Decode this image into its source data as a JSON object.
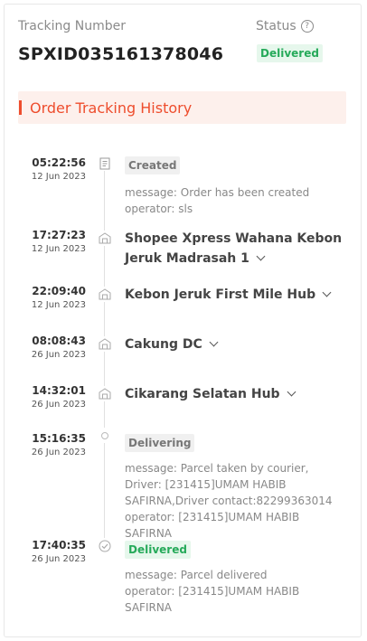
{
  "header": {
    "tracking_label": "Tracking Number",
    "tracking_number": "SPXID035161378046",
    "status_label": "Status",
    "status_value": "Delivered",
    "status_color": "#26aa5a"
  },
  "history": {
    "title": "Order Tracking History",
    "accent_color": "#ee4d2d"
  },
  "events": [
    {
      "time": "05:22:56",
      "date": "12 Jun 2023",
      "icon": "document-icon",
      "tag": "Created",
      "lines": [
        "message: Order has been created",
        "operator: sls"
      ]
    },
    {
      "time": "17:27:23",
      "date": "12 Jun 2023",
      "icon": "warehouse-icon",
      "hub": "Shopee Xpress Wahana Kebon Jeruk Madrasah 1"
    },
    {
      "time": "22:09:40",
      "date": "12 Jun 2023",
      "icon": "warehouse-icon",
      "hub": "Kebon Jeruk First Mile Hub"
    },
    {
      "time": "08:08:43",
      "date": "26 Jun 2023",
      "icon": "warehouse-icon",
      "hub": "Cakung DC"
    },
    {
      "time": "14:32:01",
      "date": "26 Jun 2023",
      "icon": "warehouse-icon",
      "hub": "Cikarang Selatan Hub"
    },
    {
      "time": "15:16:35",
      "date": "26 Jun 2023",
      "icon": "dot-icon",
      "tag": "Delivering",
      "lines": [
        "message: Parcel taken by courier, Driver: [231415]UMAM HABIB SAFIRNA,Driver contact:82299363014",
        "operator: [231415]UMAM HABIB SAFIRNA"
      ]
    },
    {
      "time": "17:40:35",
      "date": "26 Jun 2023",
      "icon": "check-circle-icon",
      "tag": "Delivered",
      "lines": [
        "message: Parcel delivered",
        "operator: [231415]UMAM HABIB SAFIRNA"
      ]
    }
  ]
}
